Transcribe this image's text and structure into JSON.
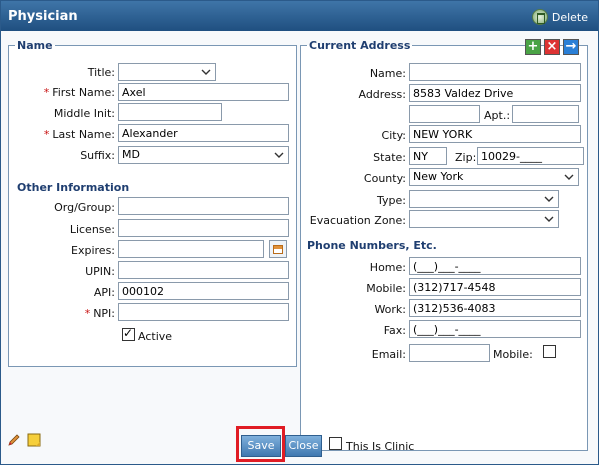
{
  "window": {
    "title": "Physician",
    "delete_label": "Delete"
  },
  "name_section": {
    "legend": "Name",
    "title_label": "Title:",
    "title_value": "",
    "first_name_label": "First Name:",
    "first_name_value": "Axel",
    "middle_init_label": "Middle Init:",
    "middle_init_value": "",
    "last_name_label": "Last Name:",
    "last_name_value": "Alexander",
    "suffix_label": "Suffix:",
    "suffix_value": "MD"
  },
  "other_info": {
    "heading": "Other Information",
    "org_label": "Org/Group:",
    "org_value": "",
    "license_label": "License:",
    "license_value": "",
    "expires_label": "Expires:",
    "expires_value": "",
    "upin_label": "UPIN:",
    "upin_value": "",
    "api_label": "API:",
    "api_value": "000102",
    "npi_label": "NPI:",
    "npi_value": "",
    "active_label": "Active",
    "active_checked": true
  },
  "address": {
    "legend": "Current Address",
    "name_label": "Name:",
    "name_value": "",
    "address_label": "Address:",
    "address_value": "8583 Valdez Drive",
    "address2_value": "",
    "apt_label": "Apt.:",
    "apt_value": "",
    "city_label": "City:",
    "city_value": "NEW YORK",
    "state_label": "State:",
    "state_value": "NY",
    "zip_label": "Zip:",
    "zip_value": "10029-____",
    "county_label": "County:",
    "county_value": "New York",
    "type_label": "Type:",
    "type_value": "",
    "evac_label": "Evacuation Zone:",
    "evac_value": ""
  },
  "phones": {
    "heading": "Phone Numbers, Etc.",
    "home_label": "Home:",
    "home_value": "(___)___-____",
    "mobile_label": "Mobile:",
    "mobile_value": "(312)717-4548",
    "work_label": "Work:",
    "work_value": "(312)536-4083",
    "fax_label": "Fax:",
    "fax_value": "(___)___-____",
    "email_label": "Email:",
    "email_value": "",
    "mobile_email_label": "Mobile:"
  },
  "footer": {
    "save_label": "Save",
    "close_label": "Close",
    "clinic_label": "This Is Clinic"
  },
  "colors": {
    "titlebar": "#2b5f94",
    "accent": "#1f3e70",
    "required": "#c81010",
    "highlight": "#e01c24"
  }
}
